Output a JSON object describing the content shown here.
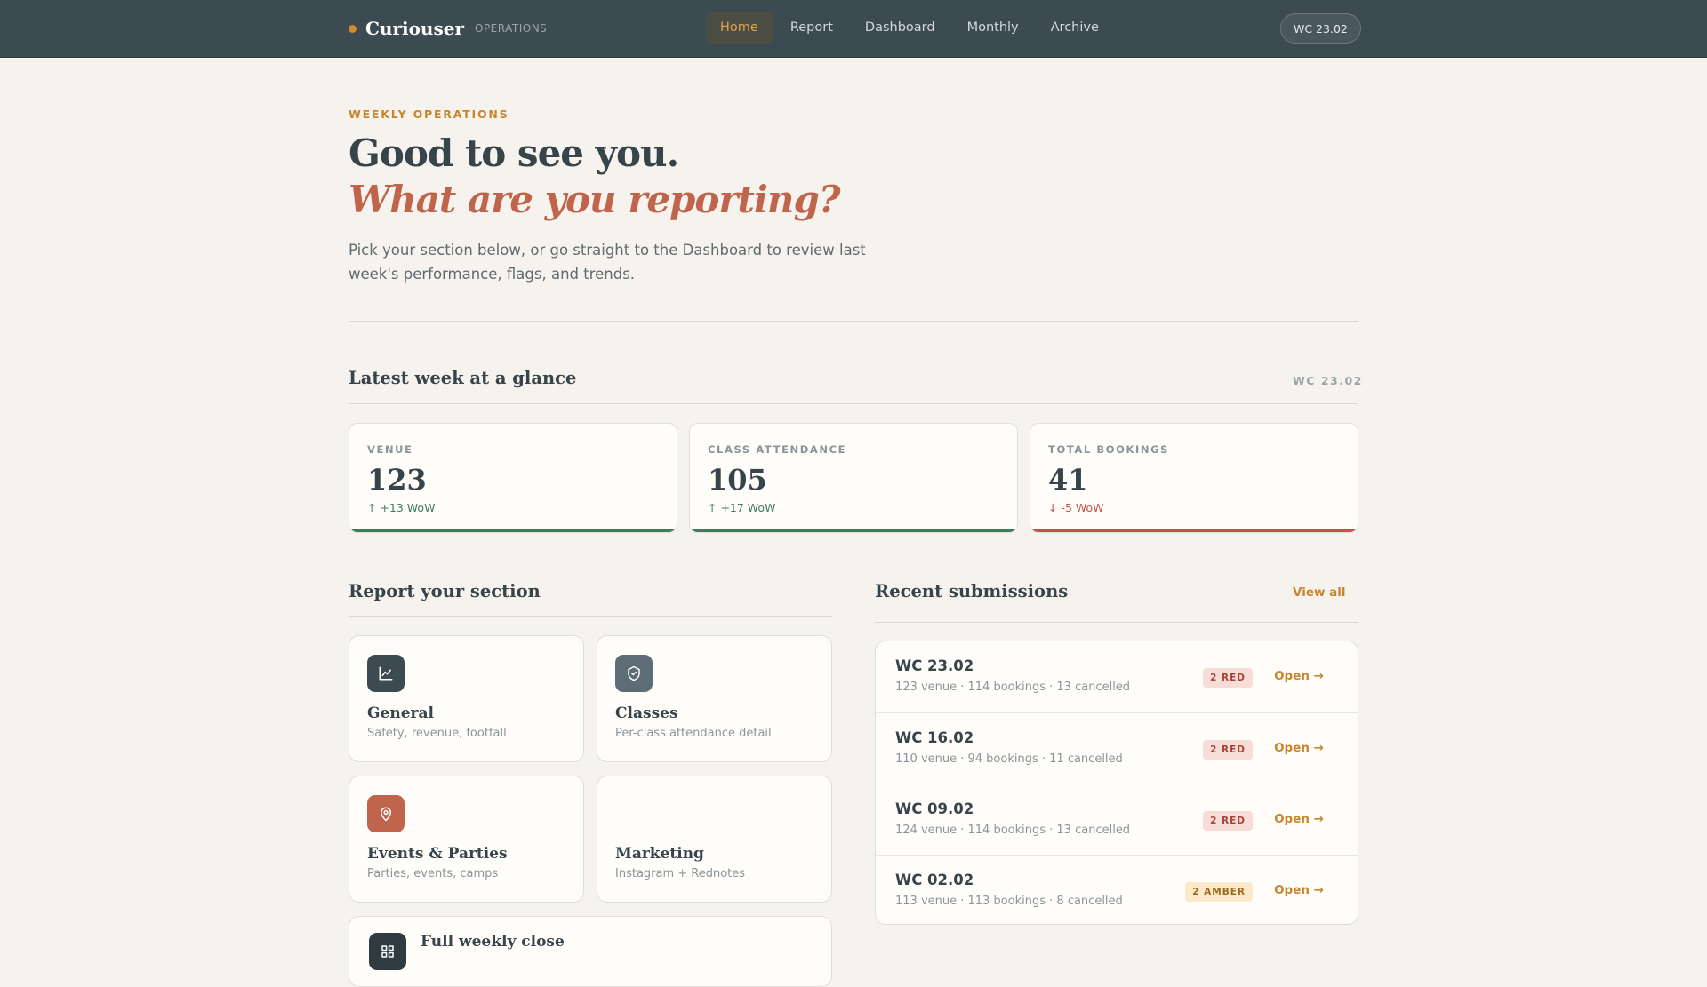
{
  "app": {
    "brand": "Curiouser",
    "brand_sub": "OPERATIONS",
    "accent_color": "#d58a2a"
  },
  "nav": {
    "items": [
      {
        "label": "Home",
        "active": true
      },
      {
        "label": "Report",
        "active": false
      },
      {
        "label": "Dashboard",
        "active": false
      },
      {
        "label": "Monthly",
        "active": false
      },
      {
        "label": "Archive",
        "active": false
      }
    ],
    "week_pill": "WC 23.02"
  },
  "hero": {
    "eyebrow": "WEEKLY OPERATIONS",
    "title": "Good to see you.",
    "subtitle": "What are you reporting?",
    "description": "Pick your section below, or go straight to the Dashboard to review last week's performance, flags, and trends."
  },
  "glance": {
    "title": "Latest week at a glance",
    "week": "WC 23.02",
    "stats": [
      {
        "label": "VENUE",
        "value": "123",
        "delta": "↑ +13 WoW",
        "trend": "up",
        "bar_color": "#3f7d5a"
      },
      {
        "label": "CLASS ATTENDANCE",
        "value": "105",
        "delta": "↑ +17 WoW",
        "trend": "up",
        "bar_color": "#3f7d5a"
      },
      {
        "label": "TOTAL BOOKINGS",
        "value": "41",
        "delta": "↓ -5 WoW",
        "trend": "down",
        "bar_color": "#c0544a"
      }
    ]
  },
  "report": {
    "title": "Report your section",
    "sections": [
      {
        "title": "General",
        "subtitle": "Safety, revenue, footfall",
        "icon": "chart-line-icon",
        "icon_bg": "#3c4a51"
      },
      {
        "title": "Classes",
        "subtitle": "Per-class attendance detail",
        "icon": "shield-check-icon",
        "icon_bg": "#5e6d75"
      },
      {
        "title": "Events & Parties",
        "subtitle": "Parties, events, camps",
        "icon": "map-pin-icon",
        "icon_bg": "#c0654c"
      },
      {
        "title": "Marketing",
        "subtitle": "Instagram + Rednotes",
        "icon": "",
        "icon_bg": ""
      }
    ],
    "full_close": {
      "title": "Full weekly close",
      "icon": "grid-icon",
      "icon_bg": "#2f3b40"
    }
  },
  "recent": {
    "title": "Recent submissions",
    "view_all": "View all",
    "rows": [
      {
        "week": "WC 23.02",
        "summary": "123 venue · 114 bookings · 13 cancelled",
        "badge": "2 RED",
        "badge_type": "red",
        "action": "Open →"
      },
      {
        "week": "WC 16.02",
        "summary": "110 venue · 94 bookings · 11 cancelled",
        "badge": "2 RED",
        "badge_type": "red",
        "action": "Open →"
      },
      {
        "week": "WC 09.02",
        "summary": "124 venue · 114 bookings · 13 cancelled",
        "badge": "2 RED",
        "badge_type": "red",
        "action": "Open →"
      },
      {
        "week": "WC 02.02",
        "summary": "113 venue · 113 bookings · 8 cancelled",
        "badge": "2 AMBER",
        "badge_type": "amber",
        "action": "Open →"
      }
    ]
  }
}
